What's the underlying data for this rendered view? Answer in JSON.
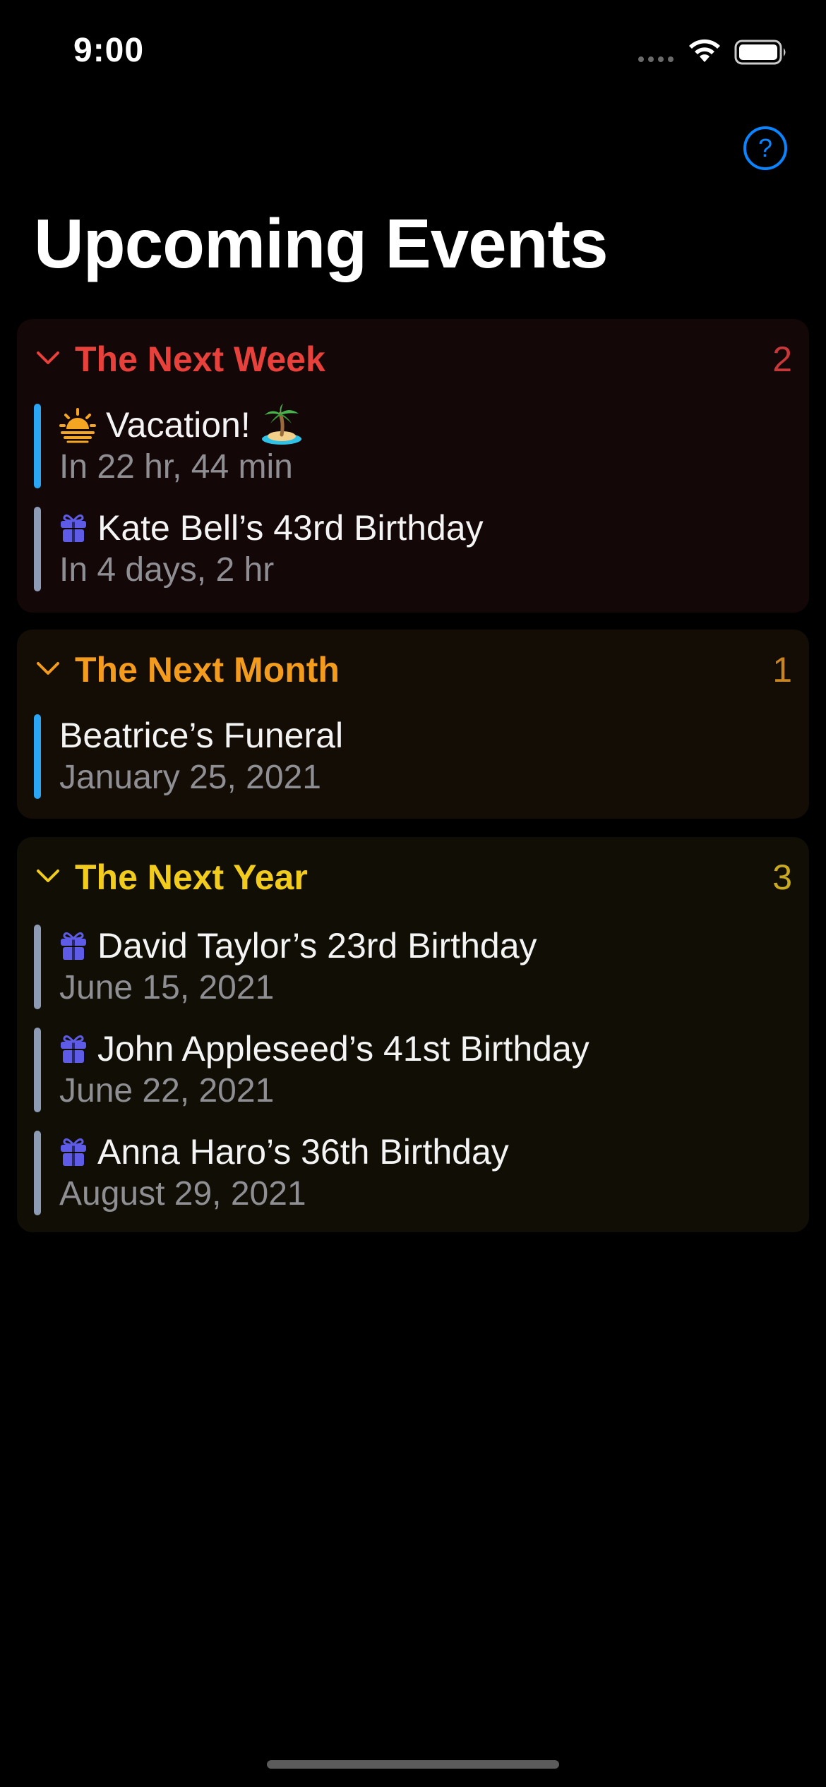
{
  "status_bar": {
    "time": "9:00"
  },
  "header": {
    "title": "Upcoming Events",
    "help_icon": "question-circle-icon"
  },
  "colors": {
    "next_week": "#e8403a",
    "next_month": "#f29b1d",
    "next_year": "#f2cc1c",
    "accent_blue": "#0a84ff",
    "bar_blue": "#2aa6f5",
    "bar_gray": "#8e9bb5",
    "gift_purple": "#5e5ce6"
  },
  "sections": [
    {
      "title": "The Next Week",
      "count": "2",
      "events": [
        {
          "title": "Vacation!",
          "subtitle": "In 22 hr, 44 min",
          "icon": "sunrise-icon",
          "trailing_icon": "desert-island-icon"
        },
        {
          "title": "Kate Bell’s 43rd Birthday",
          "subtitle": "In 4 days, 2 hr",
          "icon": "gift-icon"
        }
      ]
    },
    {
      "title": "The Next Month",
      "count": "1",
      "events": [
        {
          "title": "Beatrice’s Funeral",
          "subtitle": "January 25, 2021"
        }
      ]
    },
    {
      "title": "The Next Year",
      "count": "3",
      "events": [
        {
          "title": "David Taylor’s 23rd Birthday",
          "subtitle": "June 15, 2021",
          "icon": "gift-icon"
        },
        {
          "title": "John Appleseed’s 41st Birthday",
          "subtitle": "June 22, 2021",
          "icon": "gift-icon"
        },
        {
          "title": "Anna Haro’s 36th Birthday",
          "subtitle": "August 29, 2021",
          "icon": "gift-icon"
        }
      ]
    }
  ]
}
